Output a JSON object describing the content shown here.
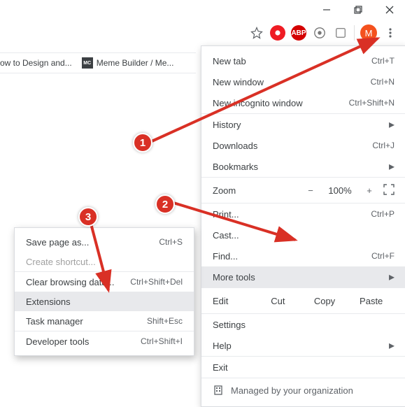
{
  "window_controls": {
    "min": "minimize",
    "max": "maximize",
    "close": "close"
  },
  "toolbar": {
    "star": "bookmark-star",
    "extensions": [
      "ublock",
      "abp",
      "ext3",
      "ext4"
    ],
    "avatar_letter": "M",
    "menu": "customize"
  },
  "bookmarks": [
    {
      "label": "ow to Design and..."
    },
    {
      "label": "Meme Builder / Me...",
      "fav": "MC"
    }
  ],
  "menu": {
    "new_tab": {
      "label": "New tab",
      "shortcut": "Ctrl+T"
    },
    "new_window": {
      "label": "New window",
      "shortcut": "Ctrl+N"
    },
    "incognito": {
      "label": "New incognito window",
      "shortcut": "Ctrl+Shift+N"
    },
    "history": {
      "label": "History"
    },
    "downloads": {
      "label": "Downloads",
      "shortcut": "Ctrl+J"
    },
    "bookmarks_m": {
      "label": "Bookmarks"
    },
    "zoom": {
      "label": "Zoom",
      "value": "100%",
      "minus": "−",
      "plus": "+"
    },
    "print": {
      "label": "Print...",
      "shortcut": "Ctrl+P"
    },
    "cast": {
      "label": "Cast..."
    },
    "find": {
      "label": "Find...",
      "shortcut": "Ctrl+F"
    },
    "more_tools": {
      "label": "More tools"
    },
    "edit": {
      "label": "Edit",
      "cut": "Cut",
      "copy": "Copy",
      "paste": "Paste"
    },
    "settings": {
      "label": "Settings"
    },
    "help": {
      "label": "Help"
    },
    "exit": {
      "label": "Exit"
    },
    "managed": {
      "label": "Managed by your organization"
    }
  },
  "submenu": {
    "save_page": {
      "label": "Save page as...",
      "shortcut": "Ctrl+S"
    },
    "create_shortcut": {
      "label": "Create shortcut..."
    },
    "clear_data": {
      "label": "Clear browsing data...",
      "shortcut": "Ctrl+Shift+Del"
    },
    "extensions": {
      "label": "Extensions"
    },
    "task_mgr": {
      "label": "Task manager",
      "shortcut": "Shift+Esc"
    },
    "devtools": {
      "label": "Developer tools",
      "shortcut": "Ctrl+Shift+I"
    }
  },
  "annotations": {
    "b1": "1",
    "b2": "2",
    "b3": "3"
  }
}
